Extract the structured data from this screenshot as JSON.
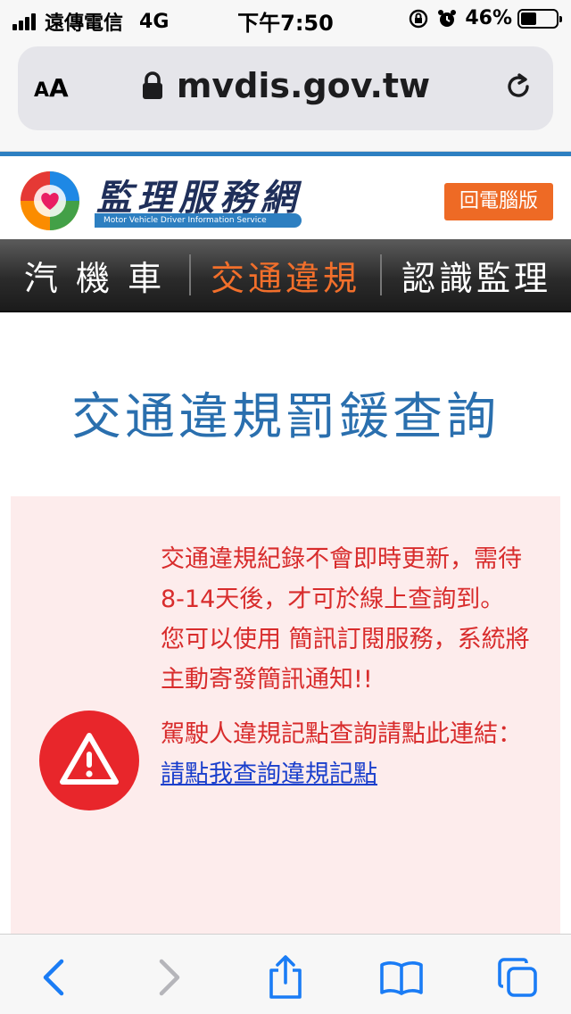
{
  "status_bar": {
    "carrier": "遠傳電信",
    "network": "4G",
    "time": "下午7:50",
    "battery_percent": "46%",
    "battery_level": 0.46
  },
  "browser": {
    "aa_label_big": "A",
    "aa_label_small": "A",
    "url": "mvdis.gov.tw"
  },
  "site": {
    "logo_cn": "監理服務網",
    "logo_en": "Motor Vehicle Driver Information Service",
    "desktop_button": "回電腦版"
  },
  "nav": {
    "items": [
      {
        "label": "汽 機 車"
      },
      {
        "label": "交通違規"
      },
      {
        "label": "認識監理"
      }
    ]
  },
  "page_title": "交通違規罰鍰查詢",
  "notice": {
    "line1": "交通違規紀錄不會即時更新，需待8-14天後，才可於線上查詢到。",
    "line2": "您可以使用 簡訊訂閱服務，系統將主動寄發簡訊通知!!",
    "line3_prefix": "駕駛人違規記點查詢請點此連結：",
    "line3_link": "請點我查詢違規記點"
  },
  "colors": {
    "accent_blue": "#2a6fae",
    "nav_active": "#f26f2b",
    "notice_red": "#d82c2c",
    "ios_blue": "#1a7cf5"
  }
}
